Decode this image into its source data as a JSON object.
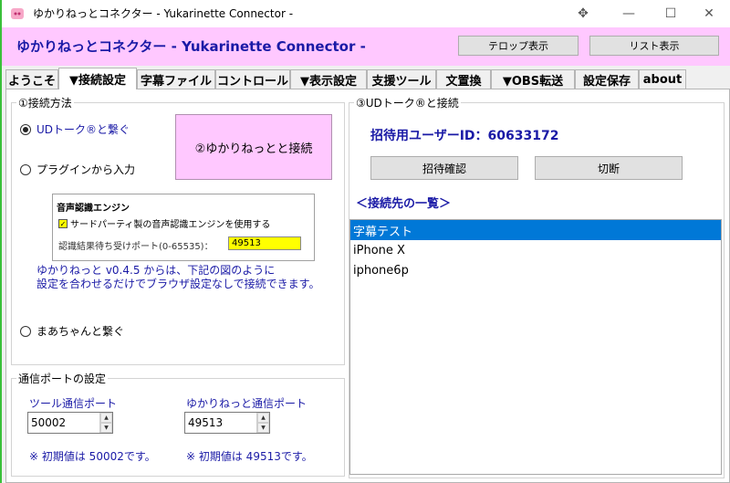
{
  "window": {
    "title": "ゆかりねっとコネクター  - Yukarinette Connector -",
    "controls": [
      "✥",
      "—",
      "☐",
      "✕"
    ]
  },
  "header": {
    "title": "ゆかりねっとコネクター  - Yukarinette Connector -",
    "telop_button": "テロップ表示",
    "list_button": "リスト表示"
  },
  "tabs": [
    {
      "label": "ようこそ"
    },
    {
      "label": "▼接続設定"
    },
    {
      "label": "字幕ファイル"
    },
    {
      "label": "コントロール"
    },
    {
      "label": "▼表示設定"
    },
    {
      "label": "支援ツール"
    },
    {
      "label": "文置換"
    },
    {
      "label": "▼OBS転送"
    },
    {
      "label": "設定保存"
    },
    {
      "label": "about"
    }
  ],
  "active_tab": "▼接続設定",
  "connection_method": {
    "legend": "①接続方法",
    "ud_talk_option": "UDトーク®と繋ぐ",
    "plugin_option": "プラグインから入力",
    "connect_button": "②ゆかりねっとと接続",
    "engine_panel": {
      "title": "音声認識エンジン",
      "checkbox_label": "サードパーティ製の音声認識エンジンを使用する",
      "port_label": "認識結果待ち受けポート(0-65535)：",
      "port_value": "49513"
    },
    "note_line1": "ゆかりねっと v0.4.5 からは、下記の図のように",
    "note_line2": "設定を合わせるだけでブラウザ設定なしで接続できます。",
    "maa_option": "まあちゃんと繋ぐ",
    "selected": "ud_talk"
  },
  "comm_ports": {
    "legend": "通信ポートの設定",
    "tool_port_label": "ツール通信ポート",
    "tool_port_value": "50002",
    "tool_port_default": "※ 初期値は 50002です。",
    "yukari_port_label": "ゆかりねっと通信ポート",
    "yukari_port_value": "49513",
    "yukari_port_default": "※ 初期値は 49513です。"
  },
  "ud_talk": {
    "legend": "③UDトーク®と接続",
    "invite_user_id": "招待用ユーザーID：60633172",
    "confirm_button": "招待確認",
    "disconnect_button": "切断",
    "list_heading": "＜接続先の一覧＞",
    "devices": [
      "字幕テスト",
      "iPhone X",
      "iphone6p"
    ],
    "selected_device": "字幕テスト"
  },
  "colors": {
    "header_bg": "#ffc8ff",
    "accent_blue": "#1a1aa6",
    "selection": "#0078d7",
    "port_highlight": "#ffff00"
  }
}
